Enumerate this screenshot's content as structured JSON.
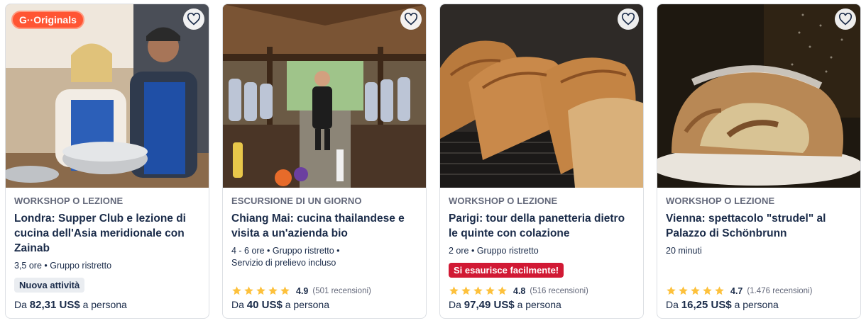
{
  "cards": [
    {
      "badge": "G··Originals",
      "category": "WORKSHOP O LEZIONE",
      "title": "Londra: Supper Club e lezione di cucina dell'Asia meridionale con Zainab",
      "meta": "3,5 ore • Gruppo ristretto",
      "tag": "Nuova attività",
      "price_prefix": "Da",
      "price": "82,31 US$",
      "price_suffix": "a persona"
    },
    {
      "category": "ESCURSIONE DI UN GIORNO",
      "title": "Chiang Mai: cucina thailandese e visita a un'azienda bio",
      "meta_line1": "4 - 6 ore • Gruppo ristretto •",
      "meta_line2": "Servizio di prelievo incluso",
      "rating": "4.9",
      "reviews": "(501 recensioni)",
      "price_prefix": "Da",
      "price": "40 US$",
      "price_suffix": "a persona"
    },
    {
      "category": "WORKSHOP O LEZIONE",
      "title": "Parigi: tour della panetteria dietro le quinte con colazione",
      "meta": "2 ore • Gruppo ristretto",
      "tag": "Si esaurisce facilmente!",
      "rating": "4.8",
      "reviews": "(516 recensioni)",
      "price_prefix": "Da",
      "price": "97,49 US$",
      "price_suffix": "a persona"
    },
    {
      "category": "WORKSHOP O LEZIONE",
      "title": "Vienna: spettacolo \"strudel\" al Palazzo di Schönbrunn",
      "meta": "20 minuti",
      "rating": "4.7",
      "reviews": "(1.476 recensioni)",
      "price_prefix": "Da",
      "price": "16,25 US$",
      "price_suffix": "a persona"
    }
  ],
  "colors": {
    "text": "#1a2b49",
    "muted": "#63687a",
    "star": "#fdc13c",
    "hot": "#d11934",
    "originals": "#ff5533"
  }
}
